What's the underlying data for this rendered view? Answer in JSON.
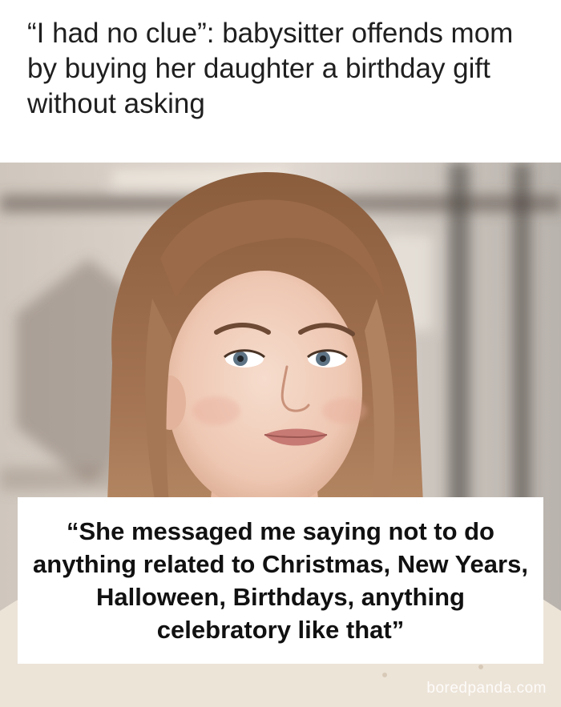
{
  "headline": "“I had no clue”: babysitter offends mom by buying her daughter a birthday gift without asking",
  "quote": "“She messaged me saying not to do anything related to Christmas, New Years, Halloween, Birthdays, anything celebratory like that”",
  "watermark": "boredpanda.com",
  "photo": {
    "subject": "young woman with long light-brown hair, worried expression"
  },
  "colors": {
    "headline_text": "#1f1f1f",
    "quote_box": "#ffffff",
    "quote_text": "#111111"
  }
}
